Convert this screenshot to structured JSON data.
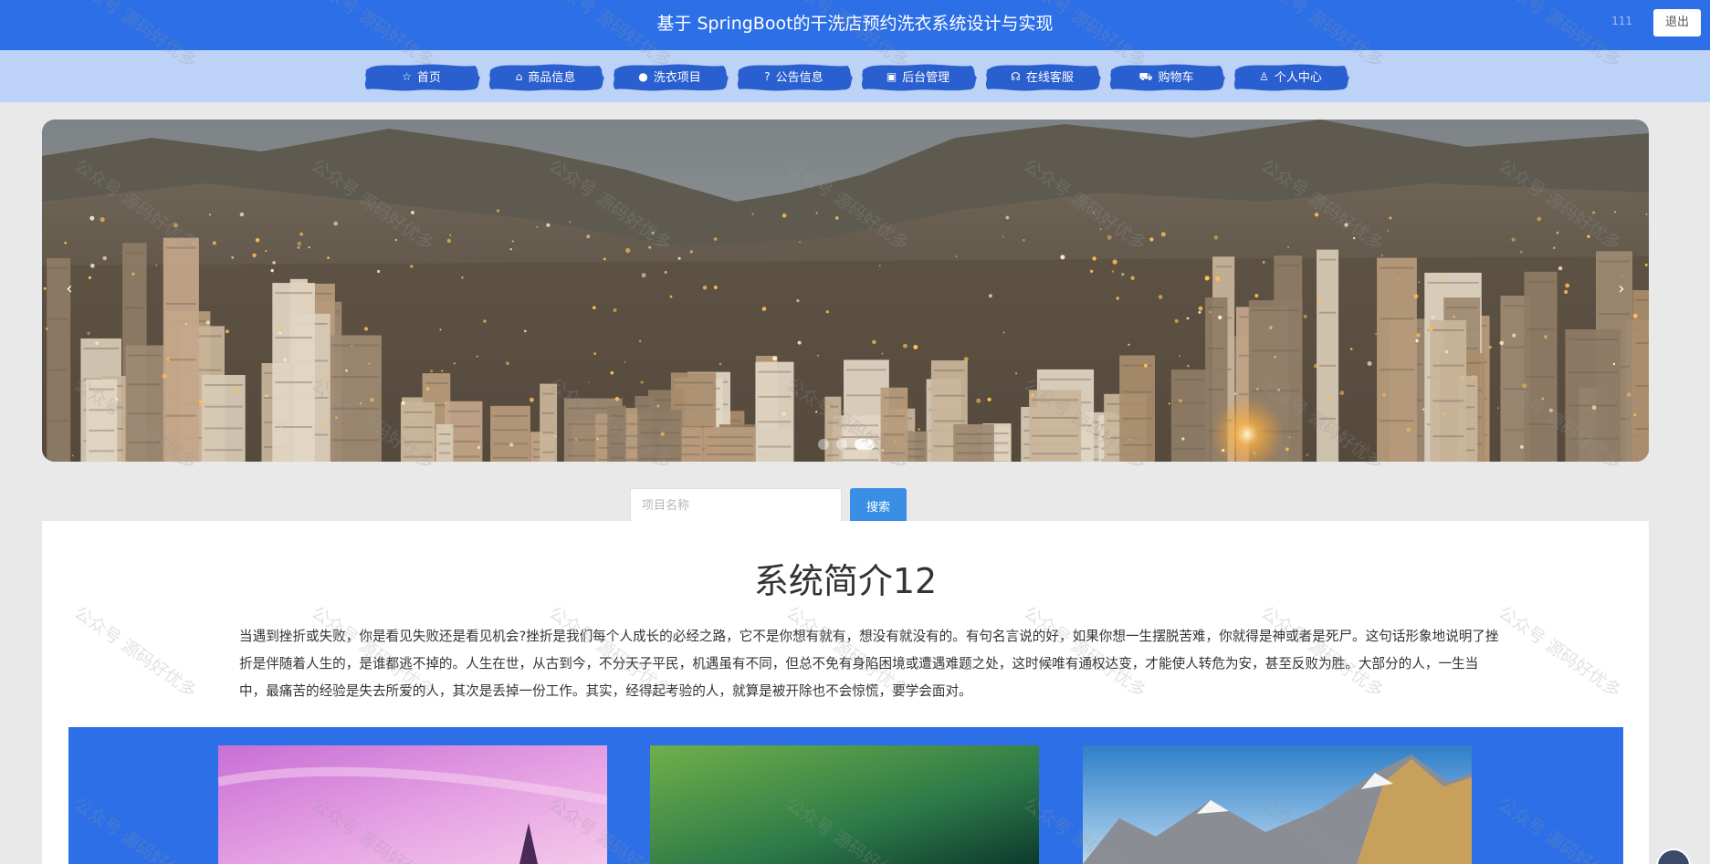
{
  "header": {
    "title": "基于 SpringBoot的干洗店预约洗衣系统设计与实现",
    "user": "111",
    "logout_label": "退出"
  },
  "nav": {
    "items": [
      {
        "label": "首页",
        "icon": "star-icon",
        "glyph": "☆"
      },
      {
        "label": "商品信息",
        "icon": "bag-icon",
        "glyph": "⌂"
      },
      {
        "label": "洗衣项目",
        "icon": "info-icon",
        "glyph": "●"
      },
      {
        "label": "公告信息",
        "icon": "question-icon",
        "glyph": "?"
      },
      {
        "label": "后台管理",
        "icon": "clipboard-icon",
        "glyph": "▣"
      },
      {
        "label": "在线客服",
        "icon": "headset-icon",
        "glyph": "☊"
      },
      {
        "label": "购物车",
        "icon": "cart-icon",
        "glyph": "⛟"
      },
      {
        "label": "个人中心",
        "icon": "user-icon",
        "glyph": "♙"
      }
    ],
    "active_index": 0,
    "brush_color": "#2a5fcf"
  },
  "carousel": {
    "prev_glyph": "‹",
    "next_glyph": "›",
    "slide_count": 3,
    "active_slide": 2
  },
  "search": {
    "placeholder": "项目名称",
    "button_label": "搜索"
  },
  "intro": {
    "title": "系统简介12",
    "text": "当遇到挫折或失败，你是看见失败还是看见机会?挫折是我们每个人成长的必经之路，它不是你想有就有，想没有就没有的。有句名言说的好，如果你想一生摆脱苦难，你就得是神或者是死尸。这句话形象地说明了挫折是伴随着人生的，是谁都逃不掉的。人生在世，从古到今，不分天子平民，机遇虽有不同，但总不免有身陷困境或遭遇难题之处，这时候唯有通权达变，才能使人转危为安，甚至反败为胜。大部分的人，一生当中，最痛苦的经验是失去所爱的人，其次是丢掉一份工作。其实，经得起考验的人，就算是被开除也不会惊慌，要学会面对。"
  },
  "watermark": "公众号 源码好优多",
  "colors": {
    "primary": "#2d6fe6",
    "nav_bg": "#bdd2f7",
    "search_button": "#3a8ee6"
  }
}
